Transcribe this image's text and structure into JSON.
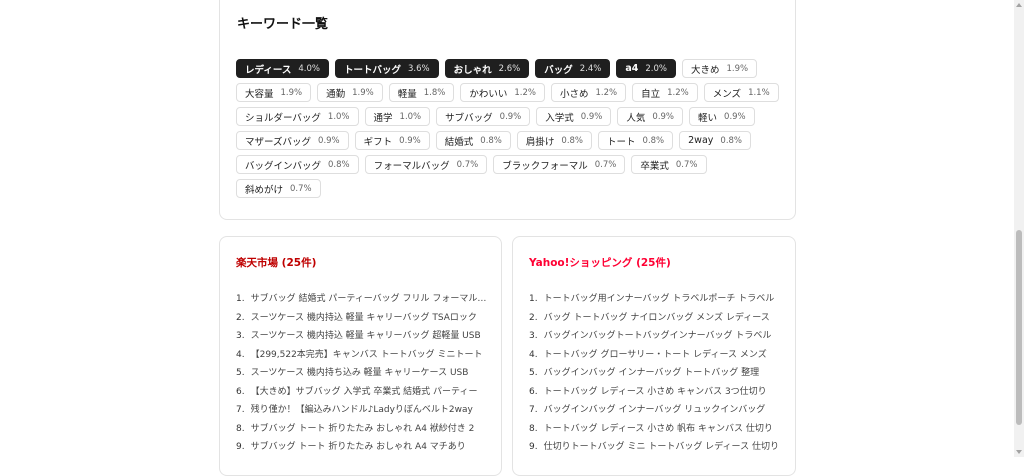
{
  "keywords": {
    "title": "キーワード一覧",
    "items": [
      {
        "label": "レディース",
        "pct": "4.0%",
        "highlight": true
      },
      {
        "label": "トートバッグ",
        "pct": "3.6%",
        "highlight": true
      },
      {
        "label": "おしゃれ",
        "pct": "2.6%",
        "highlight": true
      },
      {
        "label": "バッグ",
        "pct": "2.4%",
        "highlight": true
      },
      {
        "label": "a4",
        "pct": "2.0%",
        "highlight": true
      },
      {
        "label": "大きめ",
        "pct": "1.9%",
        "highlight": false
      },
      {
        "label": "大容量",
        "pct": "1.9%",
        "highlight": false
      },
      {
        "label": "通勤",
        "pct": "1.9%",
        "highlight": false
      },
      {
        "label": "軽量",
        "pct": "1.8%",
        "highlight": false
      },
      {
        "label": "かわいい",
        "pct": "1.2%",
        "highlight": false
      },
      {
        "label": "小さめ",
        "pct": "1.2%",
        "highlight": false
      },
      {
        "label": "自立",
        "pct": "1.2%",
        "highlight": false
      },
      {
        "label": "メンズ",
        "pct": "1.1%",
        "highlight": false
      },
      {
        "label": "ショルダーバッグ",
        "pct": "1.0%",
        "highlight": false
      },
      {
        "label": "通学",
        "pct": "1.0%",
        "highlight": false
      },
      {
        "label": "サブバッグ",
        "pct": "0.9%",
        "highlight": false
      },
      {
        "label": "入学式",
        "pct": "0.9%",
        "highlight": false
      },
      {
        "label": "人気",
        "pct": "0.9%",
        "highlight": false
      },
      {
        "label": "軽い",
        "pct": "0.9%",
        "highlight": false
      },
      {
        "label": "マザーズバッグ",
        "pct": "0.9%",
        "highlight": false
      },
      {
        "label": "ギフト",
        "pct": "0.9%",
        "highlight": false
      },
      {
        "label": "結婚式",
        "pct": "0.8%",
        "highlight": false
      },
      {
        "label": "肩掛け",
        "pct": "0.8%",
        "highlight": false
      },
      {
        "label": "トート",
        "pct": "0.8%",
        "highlight": false
      },
      {
        "label": "2way",
        "pct": "0.8%",
        "highlight": false
      },
      {
        "label": "バッグインバッグ",
        "pct": "0.8%",
        "highlight": false
      },
      {
        "label": "フォーマルバッグ",
        "pct": "0.7%",
        "highlight": false
      },
      {
        "label": "ブラックフォーマル",
        "pct": "0.7%",
        "highlight": false
      },
      {
        "label": "卒業式",
        "pct": "0.7%",
        "highlight": false
      },
      {
        "label": "斜めがけ",
        "pct": "0.7%",
        "highlight": false
      }
    ]
  },
  "rakuten": {
    "title": "楽天市場 (25件)",
    "items": [
      "サブバッグ 結婚式 パーティーバッグ フリル フォーマルバッグ",
      "スーツケース 機内持込 軽量 キャリーバッグ TSAロック",
      "スーツケース 機内持込 軽量 キャリーバッグ 超軽量 USB",
      "【299,522本完売】キャンバス トートバッグ ミニトート",
      "スーツケース 機内持ち込み 軽量 キャリーケース USB",
      "【大きめ】サブバッグ 入学式 卒業式 結婚式 パーティー",
      "残り僅か！【編込みハンドル♪Ladyりぼんベルト2way",
      "サブバッグ トート 折りたたみ おしゃれ A4 袱紗付き 2",
      "サブバッグ トート 折りたたみ おしゃれ A4 マチあり"
    ]
  },
  "yahoo": {
    "title": "Yahoo!ショッピング (25件)",
    "items": [
      "トートバッグ用インナーバッグ トラベルポーチ トラベル",
      "バッグ トートバッグ ナイロンバッグ メンズ レディース",
      "バッグインバッグトートバッグインナーバッグ トラベル",
      "トートバッグ グローサリー・トート レディース メンズ",
      "バッグインバッグ インナーバッグ トートバッグ 整理",
      "トートバッグ レディース 小さめ キャンバス 3つ仕切り",
      "バッグインバッグ インナーバッグ リュックインバッグ",
      "トートバッグ レディース 小さめ 帆布 キャンバス 仕切り",
      "仕切りトートバッグ ミニ トートバッグ レディース 仕切り"
    ]
  }
}
